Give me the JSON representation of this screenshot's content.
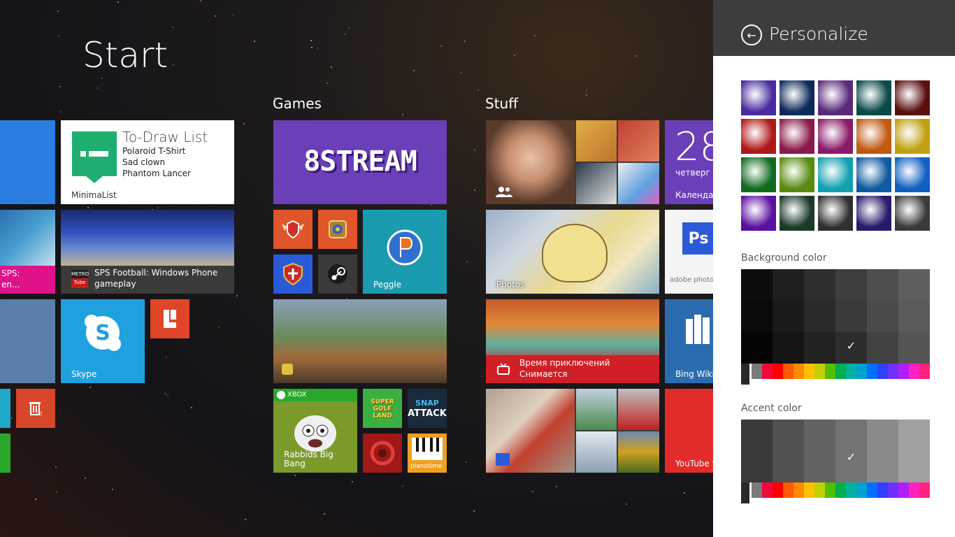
{
  "start": {
    "title": "Start"
  },
  "groups": [
    "Games",
    "Stuff"
  ],
  "tiles": {
    "todraw": {
      "title": "To-Draw List",
      "items": [
        "Polaroid T-Shirt",
        "Sad clown",
        "Phantom Lancer"
      ],
      "app": "MinimaList",
      "color": "#ffffff"
    },
    "sps_left": {
      "label": "SPS:",
      "label2": "en..."
    },
    "sps_football": {
      "label": "SPS Football: Windows Phone gameplay",
      "badge_top": "METRO",
      "badge_bottom": "Tube"
    },
    "skype": {
      "label": "Skype",
      "color": "#1fa1e0"
    },
    "eightstream": {
      "label": "8STREAM",
      "color": "#6a3fb8"
    },
    "peggle": {
      "label": "Peggle",
      "color": "#1b9bb0"
    },
    "xbox": {
      "badge": "XBOX",
      "label": "Rabbids Big Bang"
    },
    "super_golf": {
      "label": "SUPER GOLF LAND"
    },
    "snap_attack": {
      "label1": "SNAP",
      "label2": "ATTACK"
    },
    "pianotime": {
      "label": "pianotime"
    },
    "photos": {
      "label": "Photos"
    },
    "calendar": {
      "day": "28",
      "weekday": "четверг",
      "label": "Календарь",
      "color": "#6a3fb8"
    },
    "photoshop": {
      "label": "adobe photosh",
      "icon": "Ps"
    },
    "adventure": {
      "line1": "Время приключений",
      "line2": "Снимается",
      "color": "#d01f26"
    },
    "bing_wiki": {
      "label": "Bing Wikip"
    },
    "youtube": {
      "label": "YouTube f",
      "color": "#e32b2b"
    }
  },
  "panel": {
    "title": "Personalize",
    "background_label": "Background color",
    "accent_label": "Accent color",
    "check": "✓",
    "patterns": [
      "#4a2aa0",
      "#0d2a5a",
      "#5a2a7a",
      "#0a4a4a",
      "#5a1010",
      "#b01818",
      "#8a1a4a",
      "#8a1a6a",
      "#c05a10",
      "#c0a010",
      "#106a20",
      "#5a8a10",
      "#10a0b0",
      "#105aa0",
      "#1060c0",
      "#5a10a0",
      "#1a3a2a",
      "#303030",
      "#2a1a6a",
      "#3a3a3a"
    ],
    "bg_shades": [
      [
        "#0c0c0c",
        "#1e1e1e",
        "#2e2e2e",
        "#3e3e3e",
        "#4e4e4e",
        "#5e5e5e"
      ],
      [
        "#0a0a0a",
        "#1a1a1a",
        "#2a2a2a",
        "#3a3a3a",
        "#4a4a4a",
        "#5a5a5a"
      ],
      [
        "#050505",
        "#141414",
        "#222222",
        "#2d2d2d",
        "#424242",
        "#555555"
      ]
    ],
    "accent_shades": [
      "#3a3a3a",
      "#505050",
      "#636363",
      "#747474",
      "#8a8a8a",
      "#a0a0a0"
    ],
    "hues": [
      "#7a7a7a",
      "#f00a3a",
      "#ff0000",
      "#ff5a00",
      "#ff8a00",
      "#ffc000",
      "#c0d000",
      "#50c000",
      "#00b050",
      "#00b0a0",
      "#00a0d0",
      "#0070ff",
      "#3040ff",
      "#7030ff",
      "#b020ff",
      "#ff20c0",
      "#ff2080"
    ]
  }
}
